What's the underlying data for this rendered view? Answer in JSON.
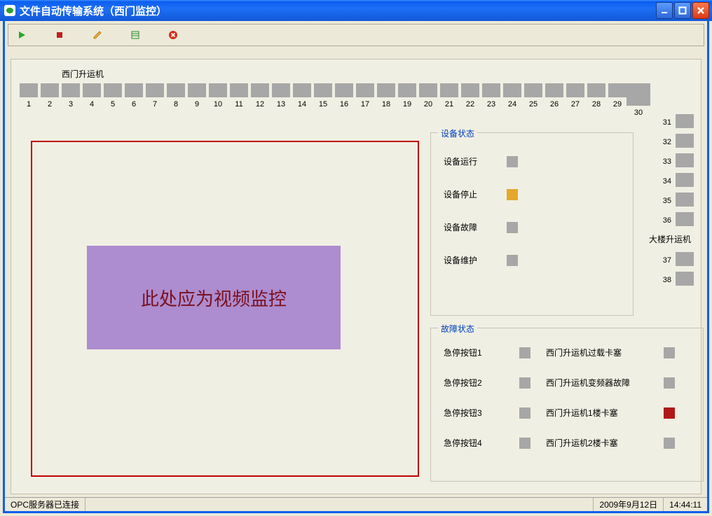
{
  "window": {
    "title": "文件自动传输系统（西门监控）"
  },
  "toolbar": {
    "play": "play",
    "stop": "stop",
    "edit": "edit",
    "list": "list",
    "error": "error"
  },
  "section_title": "西门升运机",
  "hslots": [
    "1",
    "2",
    "3",
    "4",
    "5",
    "6",
    "7",
    "8",
    "9",
    "10",
    "11",
    "12",
    "13",
    "14",
    "15",
    "16",
    "17",
    "18",
    "19",
    "20",
    "21",
    "22",
    "23",
    "24",
    "25",
    "26",
    "27",
    "28",
    "29",
    "30"
  ],
  "vslots_top": [
    "31",
    "32",
    "33",
    "34",
    "35",
    "36"
  ],
  "vlabel": "大楼升运机",
  "vslots_bottom": [
    "37",
    "38"
  ],
  "video_text": "此处应为视频监控",
  "status_group": {
    "legend": "设备状态",
    "items": [
      {
        "label": "设备运行",
        "color": "gray"
      },
      {
        "label": "设备停止",
        "color": "orange"
      },
      {
        "label": "设备故障",
        "color": "gray"
      },
      {
        "label": "设备维护",
        "color": "gray"
      }
    ]
  },
  "fault_group": {
    "legend": "故障状态",
    "rows": [
      {
        "l": "急停按钮1",
        "lcolor": "gray",
        "r": "西门升运机过载卡塞",
        "rcolor": "gray"
      },
      {
        "l": "急停按钮2",
        "lcolor": "gray",
        "r": "西门升运机变频器故障",
        "rcolor": "gray"
      },
      {
        "l": "急停按钮3",
        "lcolor": "gray",
        "r": "西门升运机1楼卡塞",
        "rcolor": "red"
      },
      {
        "l": "急停按钮4",
        "lcolor": "gray",
        "r": "西门升运机2楼卡塞",
        "rcolor": "gray"
      }
    ]
  },
  "statusbar": {
    "left": "OPC服务器已连接",
    "date": "2009年9月12日",
    "time": "14:44:11"
  }
}
